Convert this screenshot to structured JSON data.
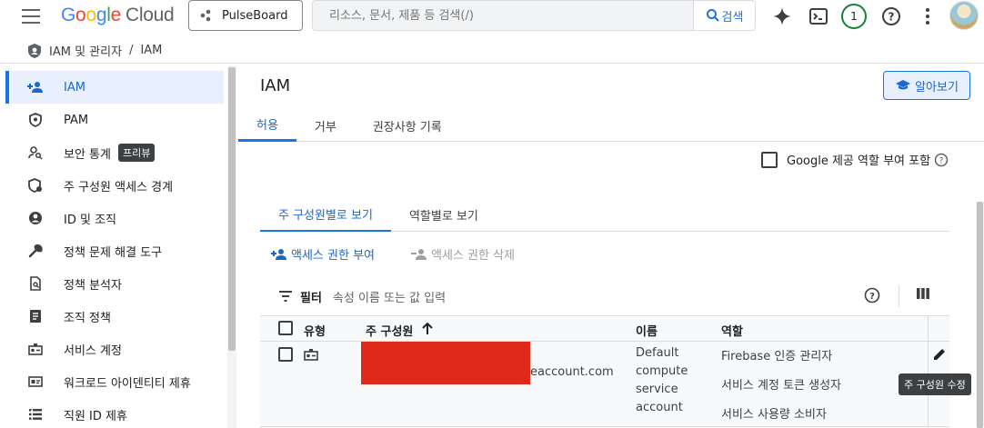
{
  "topbar": {
    "logo": {
      "g1": "G",
      "g2": "o",
      "g3": "o",
      "g4": "g",
      "g5": "l",
      "g6": "e",
      "cloud": "Cloud"
    },
    "project": "PulseBoard",
    "search_placeholder": "리소스, 문서, 제품 등 검색(/)",
    "search_button": "검색",
    "notification_count": "1"
  },
  "breadcrumb": {
    "section": "IAM 및 관리자",
    "separator": "/",
    "page": "IAM"
  },
  "sidebar": {
    "items": [
      {
        "label": "IAM",
        "icon": "person-add-icon",
        "active": true
      },
      {
        "label": "PAM",
        "icon": "shield-icon"
      },
      {
        "label": "보안 통계",
        "icon": "person-search-icon",
        "badge": "프리뷰"
      },
      {
        "label": "주 구성원 액세스 경계",
        "icon": "shield-check-icon"
      },
      {
        "label": "ID 및 조직",
        "icon": "account-circle-icon"
      },
      {
        "label": "정책 문제 해결 도구",
        "icon": "wrench-icon"
      },
      {
        "label": "정책 분석자",
        "icon": "document-search-icon"
      },
      {
        "label": "조직 정책",
        "icon": "list-document-icon"
      },
      {
        "label": "서비스 계정",
        "icon": "service-account-icon"
      },
      {
        "label": "워크로드 아이덴티티 제휴",
        "icon": "id-card-icon"
      },
      {
        "label": "직원 ID 제휴",
        "icon": "list-icon"
      }
    ]
  },
  "main": {
    "title": "IAM",
    "learn_button": "알아보기",
    "tabs": [
      "허용",
      "거부",
      "권장사항 기록"
    ],
    "google_roles_checkbox": "Google 제공 역할 부여 포함",
    "subtabs": [
      "주 구성원별로 보기",
      "역할별로 보기"
    ],
    "actions": {
      "grant": "액세스 권한 부여",
      "revoke": "액세스 권한 삭제"
    },
    "filter": {
      "label": "필터",
      "placeholder": "속성 이름 또는 값 입력"
    },
    "table": {
      "headers": {
        "type": "유형",
        "principal": "주 구성원",
        "name": "이름",
        "role": "역할"
      },
      "rows": [
        {
          "principal_suffix": "eaccount.com",
          "name": [
            "Default",
            "compute",
            "service",
            "account"
          ],
          "roles": [
            "Firebase 인증 관리자",
            "서비스 계정 토큰 생성자",
            "서비스 사용량 소비자"
          ]
        }
      ]
    },
    "tooltip": "주 구성원 수정"
  },
  "colors": {
    "accent": "#1a73e8",
    "redaction": "#e0281b"
  }
}
